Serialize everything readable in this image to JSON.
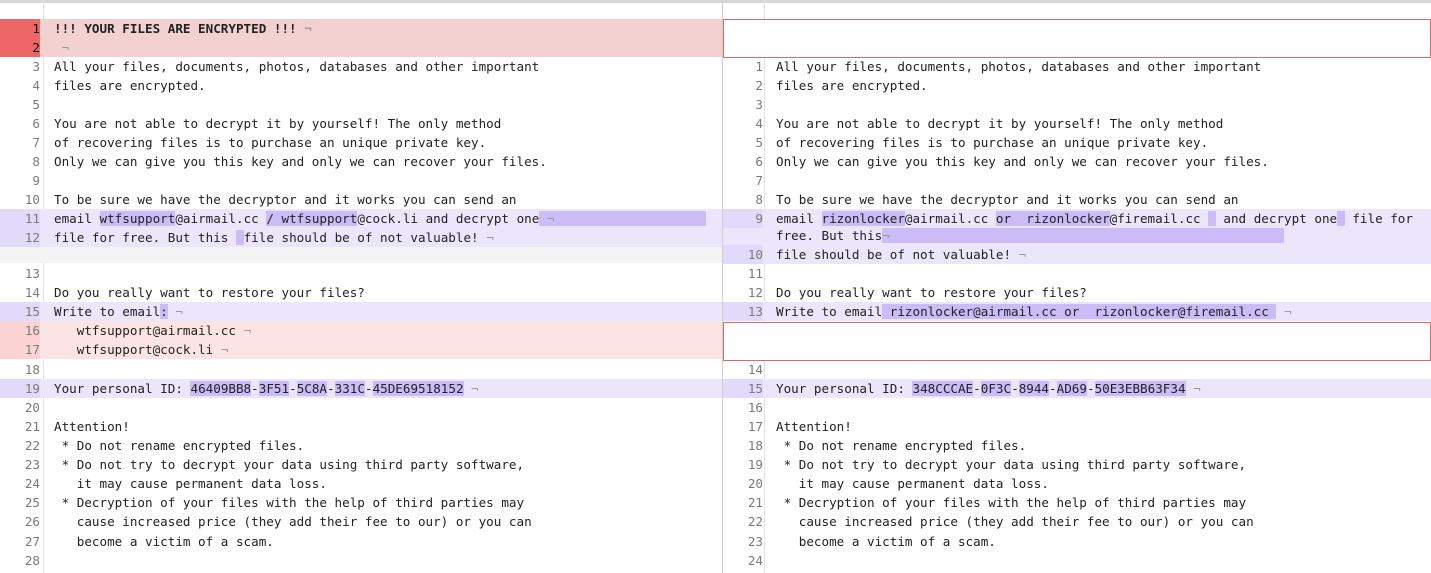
{
  "left": {
    "lines": [
      {
        "n": "1",
        "t": "!!! YOUR FILES ARE ENCRYPTED !!! "
      },
      {
        "n": "2",
        "t": " "
      },
      {
        "n": "3",
        "t": "All your files, documents, photos, databases and other important"
      },
      {
        "n": "4",
        "t": "files are encrypted."
      },
      {
        "n": "5",
        "t": ""
      },
      {
        "n": "6",
        "t": "You are not able to decrypt it by yourself! The only method"
      },
      {
        "n": "7",
        "t": "of recovering files is to purchase an unique private key."
      },
      {
        "n": "8",
        "t": "Only we can give you this key and only we can recover your files."
      },
      {
        "n": "9",
        "t": ""
      },
      {
        "n": "10",
        "t": "To be sure we have the decryptor and it works you can send an"
      },
      {
        "n": "11",
        "t": ""
      },
      {
        "n": "12",
        "t": ""
      },
      {
        "n": "13",
        "t": ""
      },
      {
        "n": "14",
        "t": "Do you really want to restore your files?"
      },
      {
        "n": "15",
        "t": ""
      },
      {
        "n": "16",
        "t": "   wtfsupport@airmail.cc "
      },
      {
        "n": "17",
        "t": "   wtfsupport@cock.li "
      },
      {
        "n": "18",
        "t": ""
      },
      {
        "n": "19",
        "t": ""
      },
      {
        "n": "20",
        "t": ""
      },
      {
        "n": "21",
        "t": "Attention!"
      },
      {
        "n": "22",
        "t": " * Do not rename encrypted files."
      },
      {
        "n": "23",
        "t": " * Do not try to decrypt your data using third party software,"
      },
      {
        "n": "24",
        "t": "   it may cause permanent data loss."
      },
      {
        "n": "25",
        "t": " * Decryption of your files with the help of third parties may"
      },
      {
        "n": "26",
        "t": "   cause increased price (they add their fee to our) or you can"
      },
      {
        "n": "27",
        "t": "   become a victim of a scam."
      },
      {
        "n": "28",
        "t": ""
      }
    ],
    "l11": {
      "a": "email ",
      "b": "wtfsupport",
      "c": "@airmail.cc ",
      "d": "/ wtfsupport",
      "e": "@cock.li",
      "f": " and decrypt one"
    },
    "l12": {
      "a": "file for free. But this ",
      "b": "file should be of not valuable!"
    },
    "l15": {
      "a": "Write to email",
      "b": ":"
    },
    "l19": {
      "a": "Your personal ID: ",
      "p1": "46409BB8",
      "s1": "-",
      "p2": "3F51",
      "s2": "-",
      "p3": "5C8A",
      "s3": "-",
      "p4": "331C",
      "s4": "-",
      "p5": "45DE69518152"
    }
  },
  "right": {
    "lines": [
      {
        "n": "1",
        "t": "All your files, documents, photos, databases and other important"
      },
      {
        "n": "2",
        "t": "files are encrypted."
      },
      {
        "n": "3",
        "t": ""
      },
      {
        "n": "4",
        "t": "You are not able to decrypt it by yourself! The only method"
      },
      {
        "n": "5",
        "t": "of recovering files is to purchase an unique private key."
      },
      {
        "n": "6",
        "t": "Only we can give you this key and only we can recover your files."
      },
      {
        "n": "7",
        "t": ""
      },
      {
        "n": "8",
        "t": "To be sure we have the decryptor and it works you can send an"
      },
      {
        "n": "9",
        "t": ""
      },
      {
        "n": "10",
        "t": ""
      },
      {
        "n": "11",
        "t": ""
      },
      {
        "n": "12",
        "t": "Do you really want to restore your files?"
      },
      {
        "n": "13",
        "t": ""
      },
      {
        "n": "14",
        "t": ""
      },
      {
        "n": "15",
        "t": ""
      },
      {
        "n": "16",
        "t": ""
      },
      {
        "n": "17",
        "t": "Attention!"
      },
      {
        "n": "18",
        "t": " * Do not rename encrypted files."
      },
      {
        "n": "19",
        "t": " * Do not try to decrypt your data using third party software,"
      },
      {
        "n": "20",
        "t": "   it may cause permanent data loss."
      },
      {
        "n": "21",
        "t": " * Decryption of your files with the help of third parties may"
      },
      {
        "n": "22",
        "t": "   cause increased price (they add their fee to our) or you can"
      },
      {
        "n": "23",
        "t": "   become a victim of a scam."
      },
      {
        "n": "24",
        "t": ""
      }
    ],
    "l9a": {
      "a": "email ",
      "b": "rizonlocker",
      "c": "@airmail.cc ",
      "d": "or  rizonlocker",
      "e": "@firemail.cc ",
      "f": " and decrypt one",
      "g": " file for"
    },
    "l9b": {
      "a": "free. But this",
      "b": ""
    },
    "l10": {
      "a": "file should be of not valuable! "
    },
    "l13": {
      "a": "Write to email",
      "b": " rizonlocker@airmail.cc or  rizonlocker@firemail.cc "
    },
    "l15": {
      "a": "Your personal ID: ",
      "p1": "348CCCAE",
      "s1": "-",
      "p2": "0F3C",
      "s2": "-",
      "p3": "8944",
      "s3": "-",
      "p4": "AD69",
      "s4": "-",
      "p5": "50E3EBB63F34"
    }
  },
  "pilcrow": "¬"
}
